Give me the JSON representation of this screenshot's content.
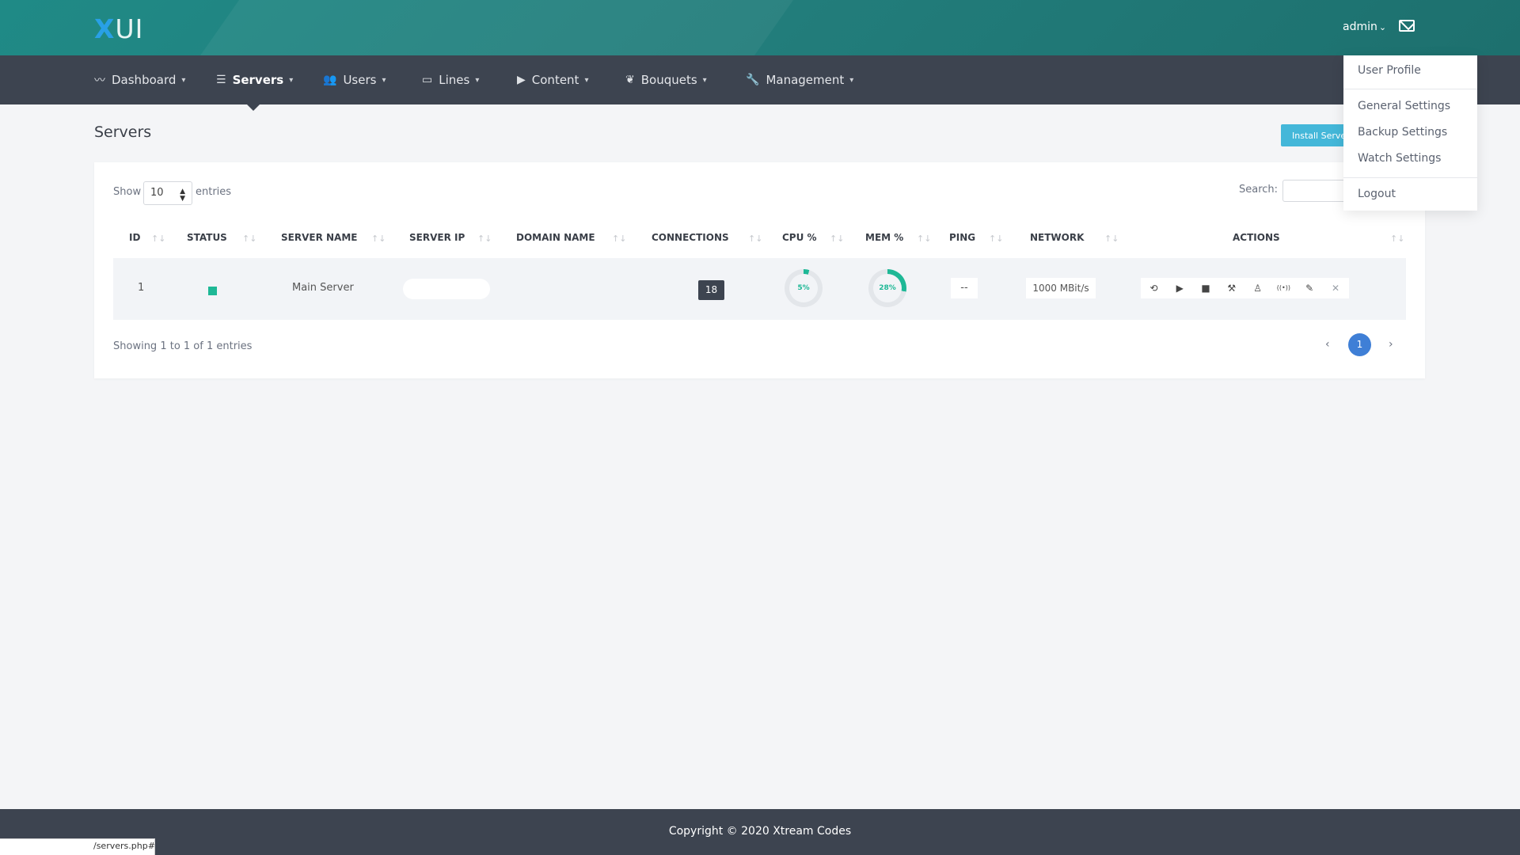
{
  "brand": {
    "logo_x": "X",
    "logo_rest": "UI"
  },
  "header": {
    "user": "admin",
    "user_chevron": "⌄"
  },
  "nav": {
    "items": [
      {
        "label": "Dashboard",
        "icon": "activity-icon"
      },
      {
        "label": "Servers",
        "icon": "server-icon",
        "active": true
      },
      {
        "label": "Users",
        "icon": "users-icon"
      },
      {
        "label": "Lines",
        "icon": "monitor-icon"
      },
      {
        "label": "Content",
        "icon": "play-icon"
      },
      {
        "label": "Bouquets",
        "icon": "bouquet-icon"
      },
      {
        "label": "Management",
        "icon": "wrench-icon"
      }
    ]
  },
  "page": {
    "title": "Servers",
    "install_button": "Install Serve"
  },
  "table_controls": {
    "show_label": "Show",
    "entries_value": "10",
    "entries_label": "entries",
    "search_label": "Search:"
  },
  "table": {
    "headers": [
      "ID",
      "STATUS",
      "SERVER NAME",
      "SERVER IP",
      "DOMAIN NAME",
      "CONNECTIONS",
      "CPU %",
      "MEM %",
      "PING",
      "NETWORK",
      "ACTIONS"
    ],
    "rows": [
      {
        "id": "1",
        "status": "online",
        "server_name": "Main Server",
        "server_ip": "",
        "domain_name": "",
        "connections": "18",
        "cpu_pct": 5,
        "cpu_label": "5%",
        "mem_pct": 28,
        "mem_label": "28%",
        "ping": "--",
        "network": "1000 MBit/s"
      }
    ],
    "row_actions": [
      {
        "name": "restart-services-icon",
        "glyph": "⟲"
      },
      {
        "name": "start-icon",
        "glyph": "▶"
      },
      {
        "name": "stop-icon",
        "glyph": "■"
      },
      {
        "name": "tools-icon",
        "glyph": "⚒"
      },
      {
        "name": "user-icon",
        "glyph": "♙"
      },
      {
        "name": "broadcast-icon",
        "glyph": "((•))"
      },
      {
        "name": "edit-icon",
        "glyph": "✎"
      },
      {
        "name": "delete-icon",
        "glyph": "✕"
      }
    ]
  },
  "pagination": {
    "info": "Showing 1 to 1 of 1 entries",
    "current_page": "1",
    "prev": "‹",
    "next": "›"
  },
  "user_menu": {
    "items": [
      "User Profile",
      "General Settings",
      "Backup Settings",
      "Watch Settings",
      "Logout"
    ]
  },
  "footer": {
    "copyright": "Copyright © 2020 Xtream Codes"
  },
  "browser_status": {
    "url": "/servers.php#"
  },
  "colors": {
    "brand_teal": "#1f8a86",
    "nav_bg": "#3d4450",
    "accent_green": "#1eb896",
    "page_blue": "#3f7fd6",
    "install_btn": "#44b7d9"
  }
}
